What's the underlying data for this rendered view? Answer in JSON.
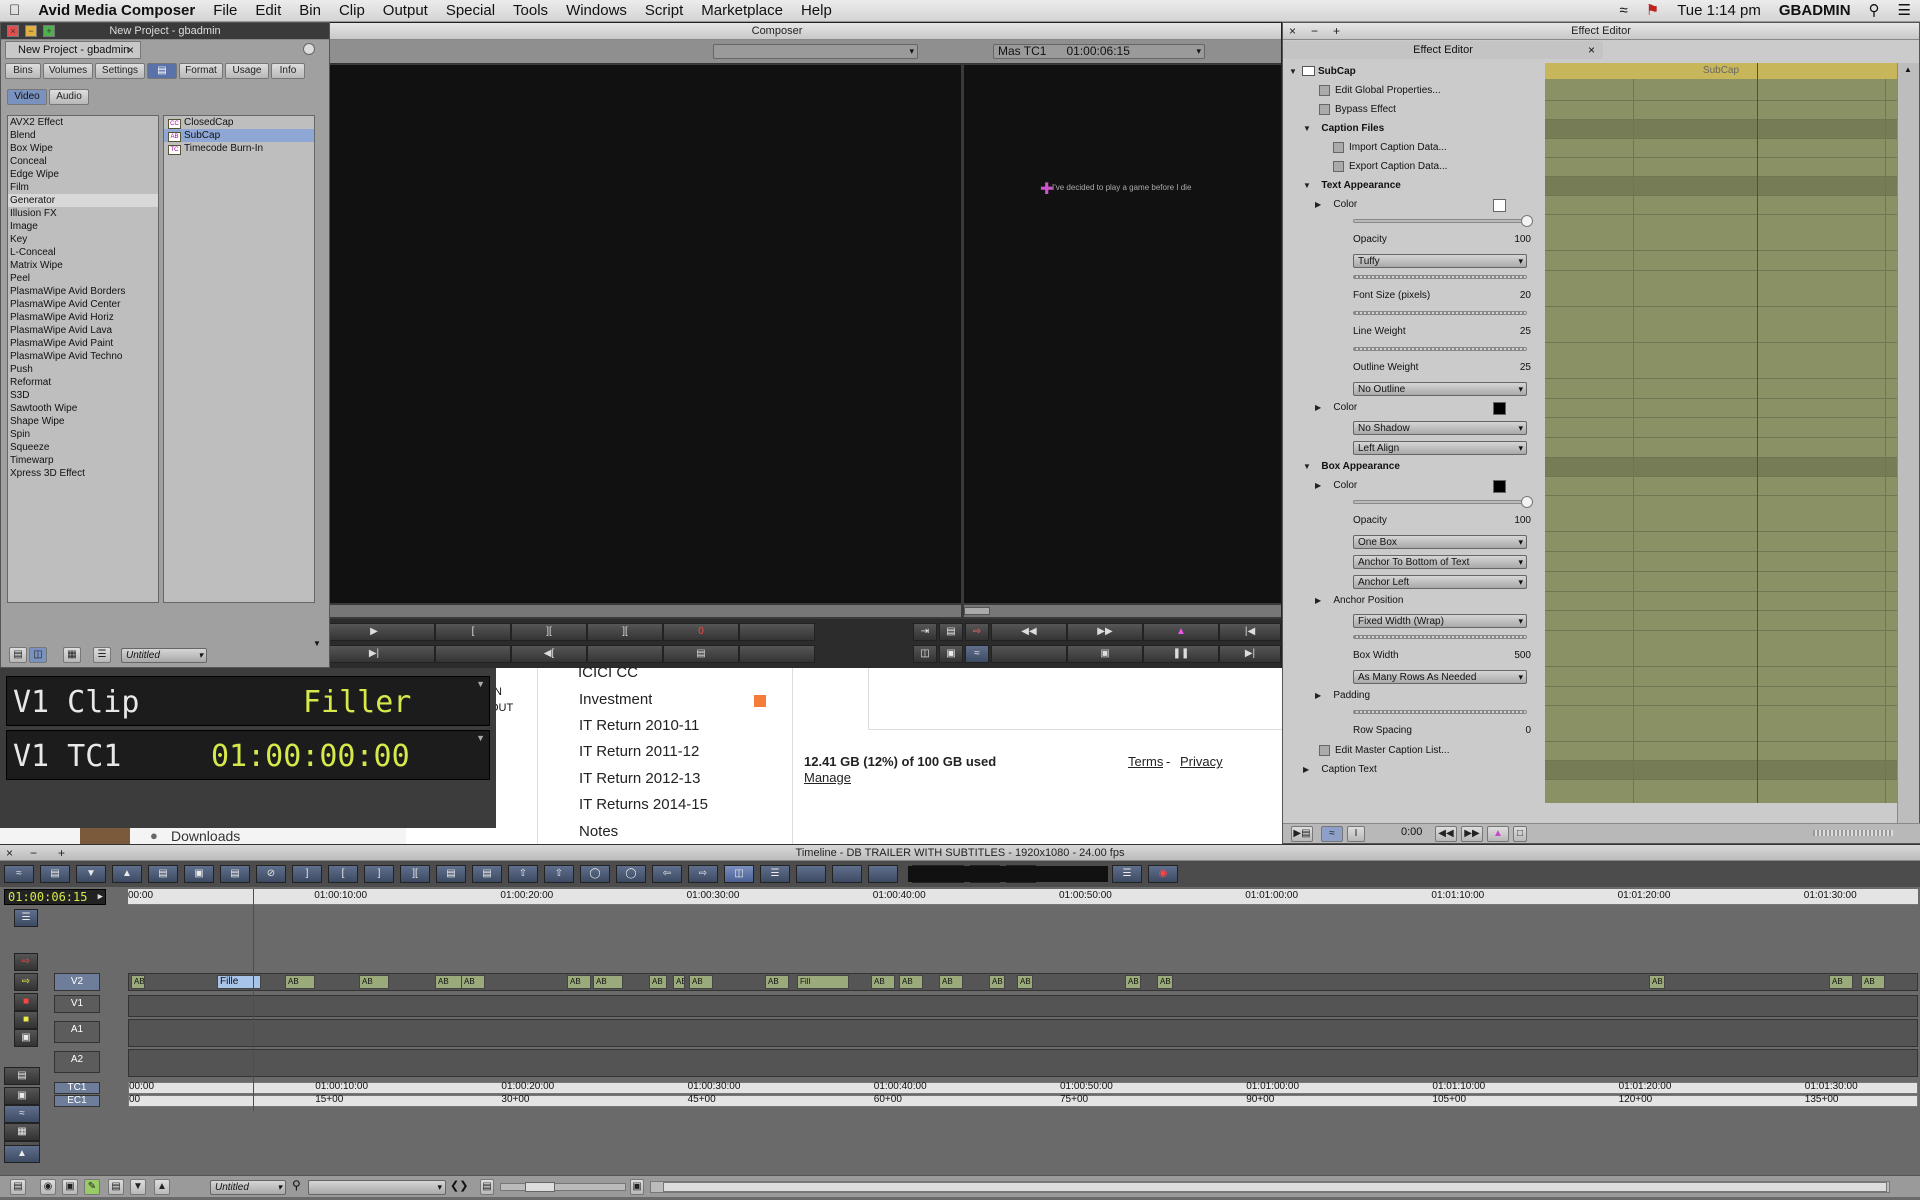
{
  "menubar": {
    "apple": "",
    "app": "Avid Media Composer",
    "items": [
      "File",
      "Edit",
      "Bin",
      "Clip",
      "Output",
      "Special",
      "Tools",
      "Windows",
      "Script",
      "Marketplace",
      "Help"
    ],
    "right": {
      "clock": "Tue 1:14 pm",
      "user": "GBADMIN"
    }
  },
  "project": {
    "title": "New Project - gbadmin",
    "tab": "New Project - gbadmin",
    "tabs": [
      "Bins",
      "Volumes",
      "Settings",
      "",
      "Format",
      "Usage",
      "Info"
    ],
    "media_tabs": [
      "Video",
      "Audio"
    ],
    "categories": [
      "AVX2 Effect",
      "Blend",
      "Box Wipe",
      "Conceal",
      "Edge Wipe",
      "Film",
      "Generator",
      "Illusion FX",
      "Image",
      "Key",
      "L-Conceal",
      "Matrix Wipe",
      "Peel",
      "PlasmaWipe Avid Borders",
      "PlasmaWipe Avid Center",
      "PlasmaWipe Avid Horiz",
      "PlasmaWipe Avid Lava",
      "PlasmaWipe Avid Paint",
      "PlasmaWipe Avid Techno",
      "Push",
      "Reformat",
      "S3D",
      "Sawtooth Wipe",
      "Shape Wipe",
      "Spin",
      "Squeeze",
      "Timewarp",
      "Xpress 3D Effect"
    ],
    "selected_category": "Generator",
    "effects": [
      {
        "label": "ClosedCap",
        "badge": "CC"
      },
      {
        "label": "SubCap",
        "badge": "AB"
      },
      {
        "label": "Timecode Burn-In",
        "badge": "TC"
      }
    ],
    "selected_effect": "SubCap",
    "bottom": {
      "bin_name": "Untitled"
    }
  },
  "composer": {
    "title": "Composer",
    "record_tc_label": "Mas TC1",
    "record_tc": "01:00:06:15",
    "caption_preview": "I've decided to play a game before I die",
    "source_mark": "0"
  },
  "info_display": {
    "row1_label": "V1 Clip",
    "row1_value": "Filler",
    "row2_label": "V1 TC1",
    "row2_value": "01:00:00:00"
  },
  "background_page": {
    "partial_top": "ICICI CC",
    "nav": [
      "Investment",
      "IT Return 2010-11",
      "IT Return 2011-12",
      "IT Return 2012-13",
      "IT Returns 2014-15",
      "Notes"
    ],
    "storage": "12.41 GB (12%) of 100 GB used",
    "manage": "Manage",
    "terms": "Terms",
    "dash": "-",
    "privacy": "Privacy",
    "downloads": "Downloads",
    "partial_left_1": "N",
    "partial_left_2": "OUT"
  },
  "effect_editor": {
    "window_title": "Effect Editor",
    "title": "Effect Editor",
    "track_label": "SubCap",
    "effect_name": "SubCap",
    "time": "0:00",
    "edit_global": "Edit Global Properties...",
    "bypass": "Bypass Effect",
    "caption_files": "Caption Files",
    "import": "Import Caption Data...",
    "export": "Export Caption Data...",
    "text_appearance": "Text Appearance",
    "color": "Color",
    "opacity": "Opacity",
    "opacity_value": "100",
    "font": "Tuffy",
    "font_size": "Font Size (pixels)",
    "font_size_value": "20",
    "line_weight": "Line Weight",
    "line_weight_value": "25",
    "outline_weight": "Outline Weight",
    "outline_weight_value": "25",
    "outline_style": "No Outline",
    "outline_color": "Color",
    "shadow": "No Shadow",
    "align": "Left Align",
    "box_appearance": "Box Appearance",
    "box_color": "Color",
    "box_opacity": "Opacity",
    "box_opacity_value": "100",
    "box_mode": "One Box",
    "anchor_to": "Anchor To Bottom of Text",
    "anchor_left": "Anchor Left",
    "anchor_position": "Anchor Position",
    "width_mode": "Fixed Width (Wrap)",
    "box_width": "Box Width",
    "box_width_value": "500",
    "rows": "As Many Rows As Needed",
    "padding": "Padding",
    "row_spacing": "Row Spacing",
    "row_spacing_value": "0",
    "edit_master": "Edit Master Caption List...",
    "caption_text": "Caption Text"
  },
  "timeline": {
    "title": "Timeline - DB TRAILER WITH SUBTITLES - 1920x1080 - 24.00 fps",
    "timecode": "01:00:06:15",
    "ruler": [
      "00:00",
      "01:00:10:00",
      "01:00:20:00",
      "01:00:30:00",
      "01:00:40:00",
      "01:00:50:00",
      "01:01:00:00",
      "01:01:10:00",
      "01:01:20:00",
      "01:01:30:00"
    ],
    "ec_ruler": [
      "00",
      "15+00",
      "30+00",
      "45+00",
      "60+00",
      "75+00",
      "90+00",
      "105+00",
      "120+00",
      "135+00"
    ],
    "tracks": [
      "V2",
      "V1",
      "A1",
      "A2",
      "TC1",
      "EC1"
    ],
    "clip_badge": "AB",
    "filler_label": "Fille",
    "filler_label2": "Fill",
    "bin_name": "Untitled",
    "playhead_ratio": 0.07
  }
}
